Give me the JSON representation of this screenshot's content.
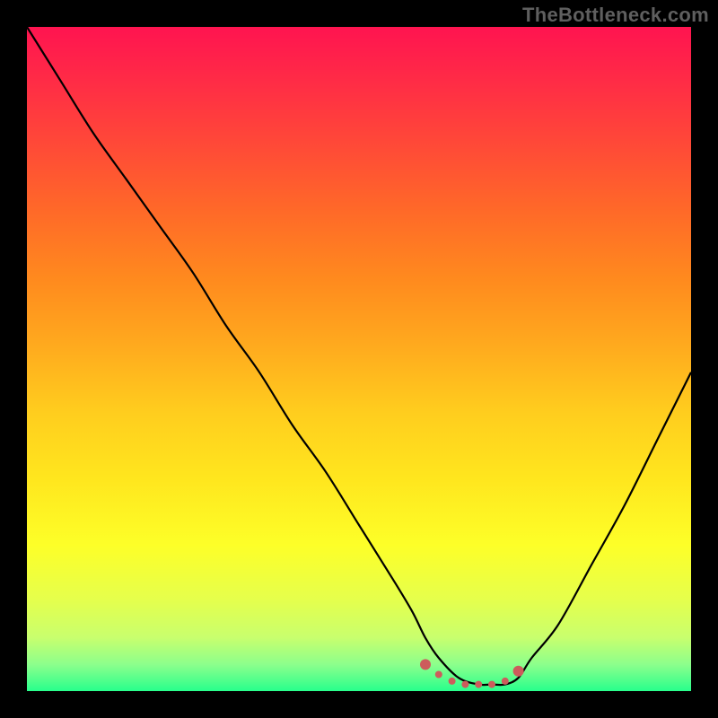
{
  "watermark": "TheBottleneck.com",
  "colors": {
    "frame": "#000000",
    "line": "#000000",
    "marker": "#cd5c5c",
    "gradient": [
      {
        "offset": 0.0,
        "color": "#ff1450"
      },
      {
        "offset": 0.08,
        "color": "#ff2b46"
      },
      {
        "offset": 0.18,
        "color": "#ff4a37"
      },
      {
        "offset": 0.28,
        "color": "#ff6a28"
      },
      {
        "offset": 0.38,
        "color": "#ff8a1e"
      },
      {
        "offset": 0.48,
        "color": "#ffaa1e"
      },
      {
        "offset": 0.58,
        "color": "#ffcd1e"
      },
      {
        "offset": 0.68,
        "color": "#ffe61e"
      },
      {
        "offset": 0.78,
        "color": "#fdff28"
      },
      {
        "offset": 0.86,
        "color": "#e6ff4b"
      },
      {
        "offset": 0.92,
        "color": "#c8ff6e"
      },
      {
        "offset": 0.96,
        "color": "#8cff8c"
      },
      {
        "offset": 1.0,
        "color": "#28ff8c"
      }
    ]
  },
  "chart_data": {
    "type": "line",
    "title": "",
    "xlabel": "",
    "ylabel": "",
    "xlim": [
      0,
      100
    ],
    "ylim": [
      0,
      100
    ],
    "x": [
      0,
      5,
      10,
      15,
      20,
      25,
      30,
      35,
      40,
      45,
      50,
      55,
      58,
      60,
      62,
      65,
      68,
      70,
      72,
      74,
      76,
      80,
      85,
      90,
      95,
      100
    ],
    "values": [
      100,
      92,
      84,
      77,
      70,
      63,
      55,
      48,
      40,
      33,
      25,
      17,
      12,
      8,
      5,
      2,
      1,
      1,
      1,
      2,
      5,
      10,
      19,
      28,
      38,
      48
    ],
    "markers": {
      "x": [
        60,
        62,
        64,
        66,
        68,
        70,
        72,
        74
      ],
      "y": [
        4,
        2.5,
        1.5,
        1,
        1,
        1,
        1.5,
        3
      ]
    }
  }
}
